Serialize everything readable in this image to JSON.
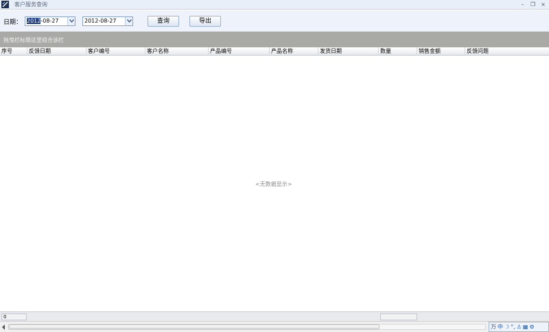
{
  "window": {
    "title": "客户服务查询",
    "min_glyph": "–",
    "restore_glyph": "❐",
    "close_glyph": "×"
  },
  "toolbar": {
    "date_label": "日期：",
    "start_date_selected": "2012",
    "start_date_rest": "-08-27",
    "end_date": "2012-08-27",
    "query_label": "查询",
    "export_label": "导出"
  },
  "group_panel": {
    "hint": "拖曳栏标题这里组合该栏"
  },
  "grid": {
    "columns": [
      "序号",
      "反馈日期",
      "客户编号",
      "客户名称",
      "产品编号",
      "产品名称",
      "发货日期",
      "数量",
      "销售金额",
      "反馈问题"
    ],
    "empty_text": "<无数据显示>"
  },
  "footer": {
    "count": "0"
  },
  "ime": {
    "items": [
      "万",
      "中",
      "☽",
      "°,",
      "♙",
      "▦",
      "⚙"
    ]
  },
  "colors": {
    "title_bg": "#e9eff8",
    "toolbar_bg": "#eef3fb",
    "group_panel_bg": "#a9aaa6",
    "selection": "#1c3a7a"
  }
}
